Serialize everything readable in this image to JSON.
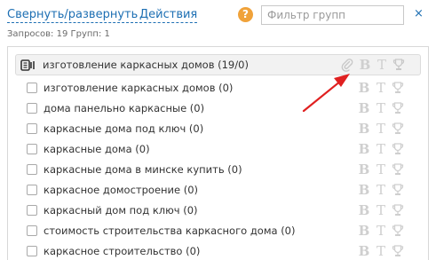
{
  "toolbar": {
    "collapse_expand": "Свернуть/развернуть",
    "actions": "Действия",
    "help": "?",
    "filter_placeholder": "Фильтр групп",
    "filter_value": "",
    "clear": "×"
  },
  "stats": "Запросов: 19  Групп: 1",
  "group": {
    "label": "изготовление каркасных домов (19/0)",
    "icons": [
      "paperclip-icon",
      "bold-b-icon",
      "text-t-icon",
      "trophy-icon"
    ]
  },
  "rows": [
    {
      "label": "изготовление каркасных домов (0)"
    },
    {
      "label": "дома панельно каркасные (0)"
    },
    {
      "label": "каркасные дома под ключ (0)"
    },
    {
      "label": "каркасные дома (0)"
    },
    {
      "label": "каркасные дома в минске купить (0)"
    },
    {
      "label": "каркасное домостроение (0)"
    },
    {
      "label": "каркасный дом под ключ (0)"
    },
    {
      "label": "стоимость строительства каркасного дома (0)"
    },
    {
      "label": "каркасное строительство (0)"
    }
  ],
  "row_icons": [
    "bold-b-icon",
    "text-t-icon",
    "trophy-icon"
  ],
  "colors": {
    "link": "#1d6fb3",
    "help": "#f0a23a",
    "arrow": "#e02020",
    "icon_muted": "#cfcfcf"
  }
}
